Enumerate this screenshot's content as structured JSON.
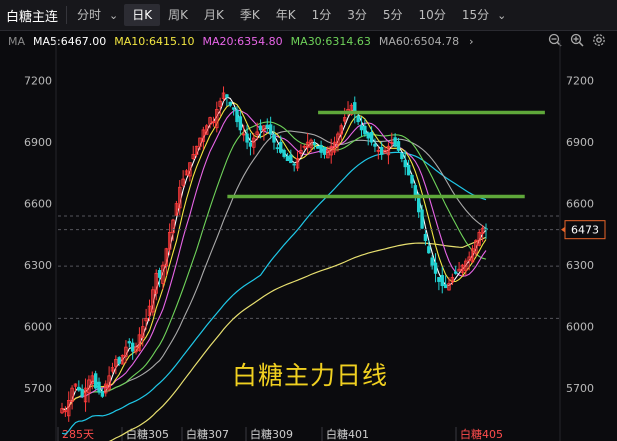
{
  "toolbar": {
    "title": "白糖主连",
    "tabs": [
      {
        "label": "分时",
        "active": false
      },
      {
        "label": "日K",
        "active": true
      },
      {
        "label": "周K",
        "active": false
      },
      {
        "label": "月K",
        "active": false
      },
      {
        "label": "季K",
        "active": false
      },
      {
        "label": "年K",
        "active": false
      },
      {
        "label": "1分",
        "active": false
      },
      {
        "label": "3分",
        "active": false
      },
      {
        "label": "5分",
        "active": false
      },
      {
        "label": "10分",
        "active": false
      },
      {
        "label": "15分",
        "active": false
      }
    ]
  },
  "ma_bar": {
    "label": "MA",
    "items": [
      {
        "text": "MA5:6467.00",
        "color": "#ffffff"
      },
      {
        "text": "MA10:6415.10",
        "color": "#f2e641"
      },
      {
        "text": "MA20:6354.80",
        "color": "#e765e7"
      },
      {
        "text": "MA30:6314.63",
        "color": "#6fd35a"
      },
      {
        "text": "MA60:6504.78",
        "color": "#aaaaaa"
      }
    ]
  },
  "tools": [
    "zoom-out-icon",
    "zoom-in-icon",
    "settings-icon"
  ],
  "chart_data": {
    "type": "candlestick",
    "annotation": "白糖主力日线",
    "y_ticks": [
      7200,
      6900,
      6600,
      6300,
      6000,
      5700
    ],
    "ylim": [
      5520,
      7340
    ],
    "current_price": "6473",
    "x_labels": [
      "285天",
      "白糖305",
      "白糖307",
      "白糖309",
      "白糖401",
      "白糖405"
    ],
    "resistance_lines": [
      {
        "y": 7045,
        "x_start": 0.52,
        "x_end": 0.97
      },
      {
        "y": 6635,
        "x_start": 0.34,
        "x_end": 0.93
      }
    ],
    "dashed_levels": [
      6540,
      6295,
      6040
    ],
    "colors": {
      "up": "#ff3b3b",
      "down": "#22d3d3",
      "ma5": "#ffffff",
      "ma10": "#f2e641",
      "ma20": "#e765e7",
      "ma30": "#6fd35a",
      "ma60": "#aaaaaa",
      "ma120": "#1fc8e8",
      "ma250": "#e8e070",
      "resistance": "#5fa83a"
    },
    "candles_close": [
      5600,
      5590,
      5640,
      5700,
      5720,
      5690,
      5660,
      5700,
      5740,
      5760,
      5700,
      5680,
      5660,
      5720,
      5760,
      5800,
      5840,
      5820,
      5860,
      5900,
      5920,
      5880,
      5900,
      5960,
      6000,
      6040,
      6100,
      6180,
      6260,
      6240,
      6300,
      6380,
      6460,
      6520,
      6600,
      6680,
      6720,
      6760,
      6800,
      6840,
      6880,
      6920,
      6960,
      6980,
      7020,
      7000,
      7060,
      7100,
      7140,
      7120,
      7080,
      7060,
      7000,
      6960,
      6940,
      6900,
      6880,
      6920,
      6950,
      6960,
      6980,
      6970,
      6940,
      6900,
      6870,
      6850,
      6830,
      6810,
      6800,
      6790,
      6820,
      6860,
      6880,
      6900,
      6910,
      6890,
      6870,
      6850,
      6840,
      6860,
      6880,
      6900,
      6940,
      6980,
      7020,
      7060,
      7080,
      7040,
      7000,
      6960,
      6940,
      6920,
      6900,
      6880,
      6860,
      6840,
      6860,
      6880,
      6900,
      6880,
      6860,
      6820,
      6780,
      6740,
      6700,
      6640,
      6560,
      6480,
      6420,
      6360,
      6300,
      6260,
      6220,
      6200,
      6190,
      6210,
      6240,
      6260,
      6280,
      6300,
      6320,
      6340,
      6380,
      6420,
      6460,
      6480,
      6473
    ]
  }
}
